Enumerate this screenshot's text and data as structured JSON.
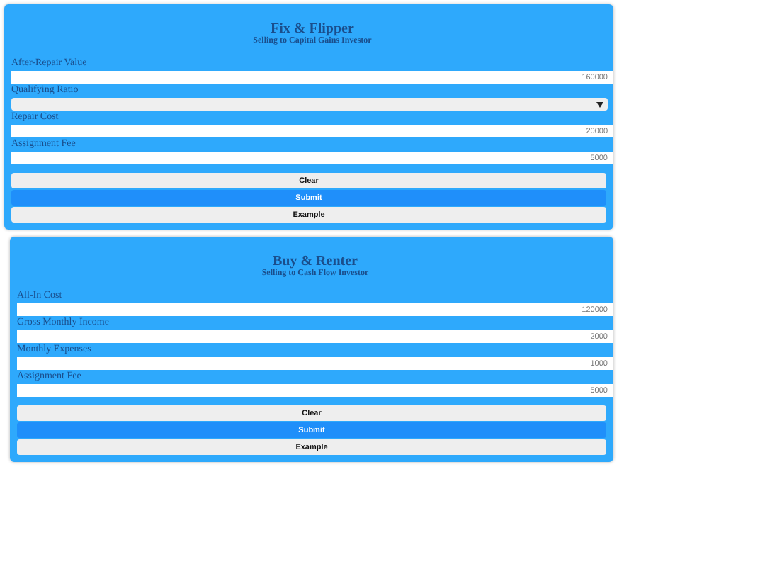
{
  "forms": [
    {
      "title": "Fix & Flipper",
      "subtitle": "Selling to Capital Gains Investor",
      "fields": [
        {
          "kind": "input",
          "label": "After-Repair Value",
          "placeholder": "160000"
        },
        {
          "kind": "select",
          "label": "Qualifying Ratio"
        },
        {
          "kind": "input",
          "label": "Repair Cost",
          "placeholder": "20000"
        },
        {
          "kind": "input",
          "label": "Assignment Fee",
          "placeholder": "5000"
        }
      ],
      "buttons": [
        {
          "kind": "plain",
          "label": "Clear"
        },
        {
          "kind": "primary",
          "label": "Submit"
        },
        {
          "kind": "plain",
          "label": "Example"
        }
      ]
    },
    {
      "title": "Buy & Renter",
      "subtitle": "Selling to Cash Flow Investor",
      "fields": [
        {
          "kind": "input",
          "label": "All-In Cost",
          "placeholder": "120000"
        },
        {
          "kind": "input",
          "label": "Gross Monthly Income",
          "placeholder": "2000"
        },
        {
          "kind": "input",
          "label": "Monthly Expenses",
          "placeholder": "1000"
        },
        {
          "kind": "input",
          "label": "Assignment Fee",
          "placeholder": "5000"
        }
      ],
      "buttons": [
        {
          "kind": "plain",
          "label": "Clear"
        },
        {
          "kind": "primary",
          "label": "Submit"
        },
        {
          "kind": "plain",
          "label": "Example"
        }
      ]
    }
  ]
}
